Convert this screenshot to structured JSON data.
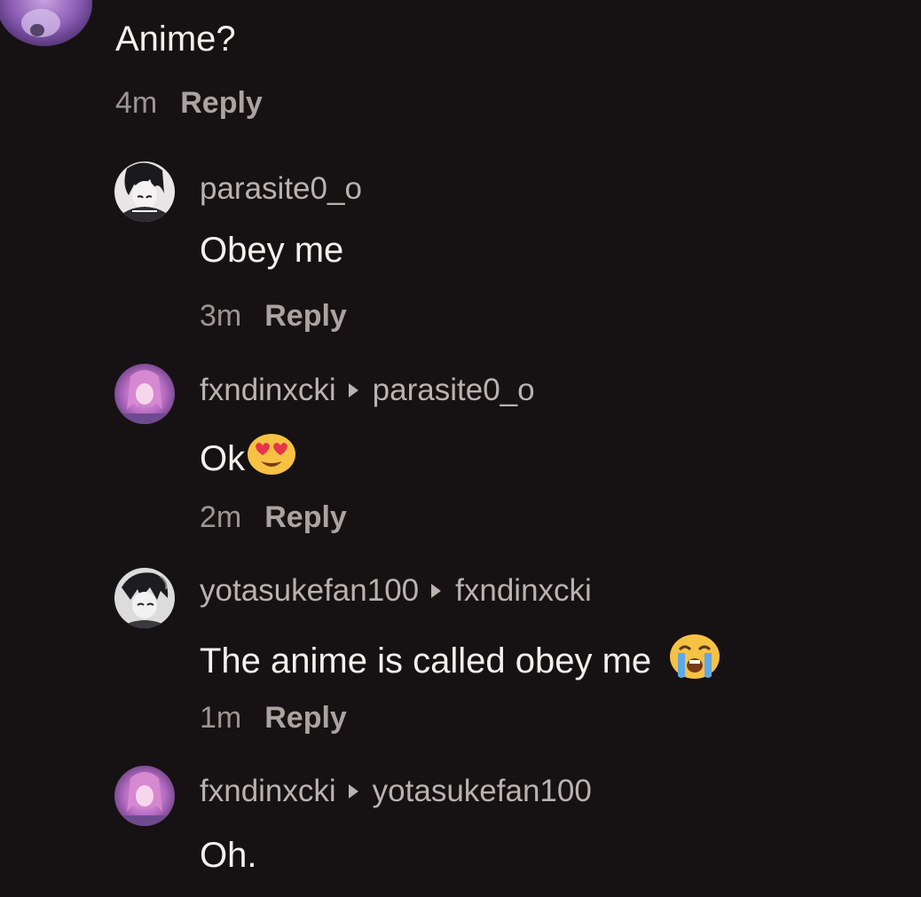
{
  "top_comment": {
    "text": "Anime?",
    "time": "4m",
    "reply_label": "Reply"
  },
  "replies": [
    {
      "username": "parasite0_o",
      "reply_to": "",
      "text": "Obey me",
      "emoji": "",
      "time": "3m",
      "reply_label": "Reply"
    },
    {
      "username": "fxndinxcki",
      "reply_to": "parasite0_o",
      "text": "Ok",
      "emoji": "heart-eyes-emoji",
      "time": "2m",
      "reply_label": "Reply"
    },
    {
      "username": "yotasukefan100",
      "reply_to": "fxndinxcki",
      "text": "The anime is called obey me",
      "emoji": "loudly-crying-emoji",
      "time": "1m",
      "reply_label": "Reply"
    },
    {
      "username": "fxndinxcki",
      "reply_to": "yotasukefan100",
      "text": "Oh.",
      "emoji": ""
    }
  ],
  "colors": {
    "background": "#161213",
    "text": "#f3f0ee",
    "muted": "#9b9694"
  }
}
